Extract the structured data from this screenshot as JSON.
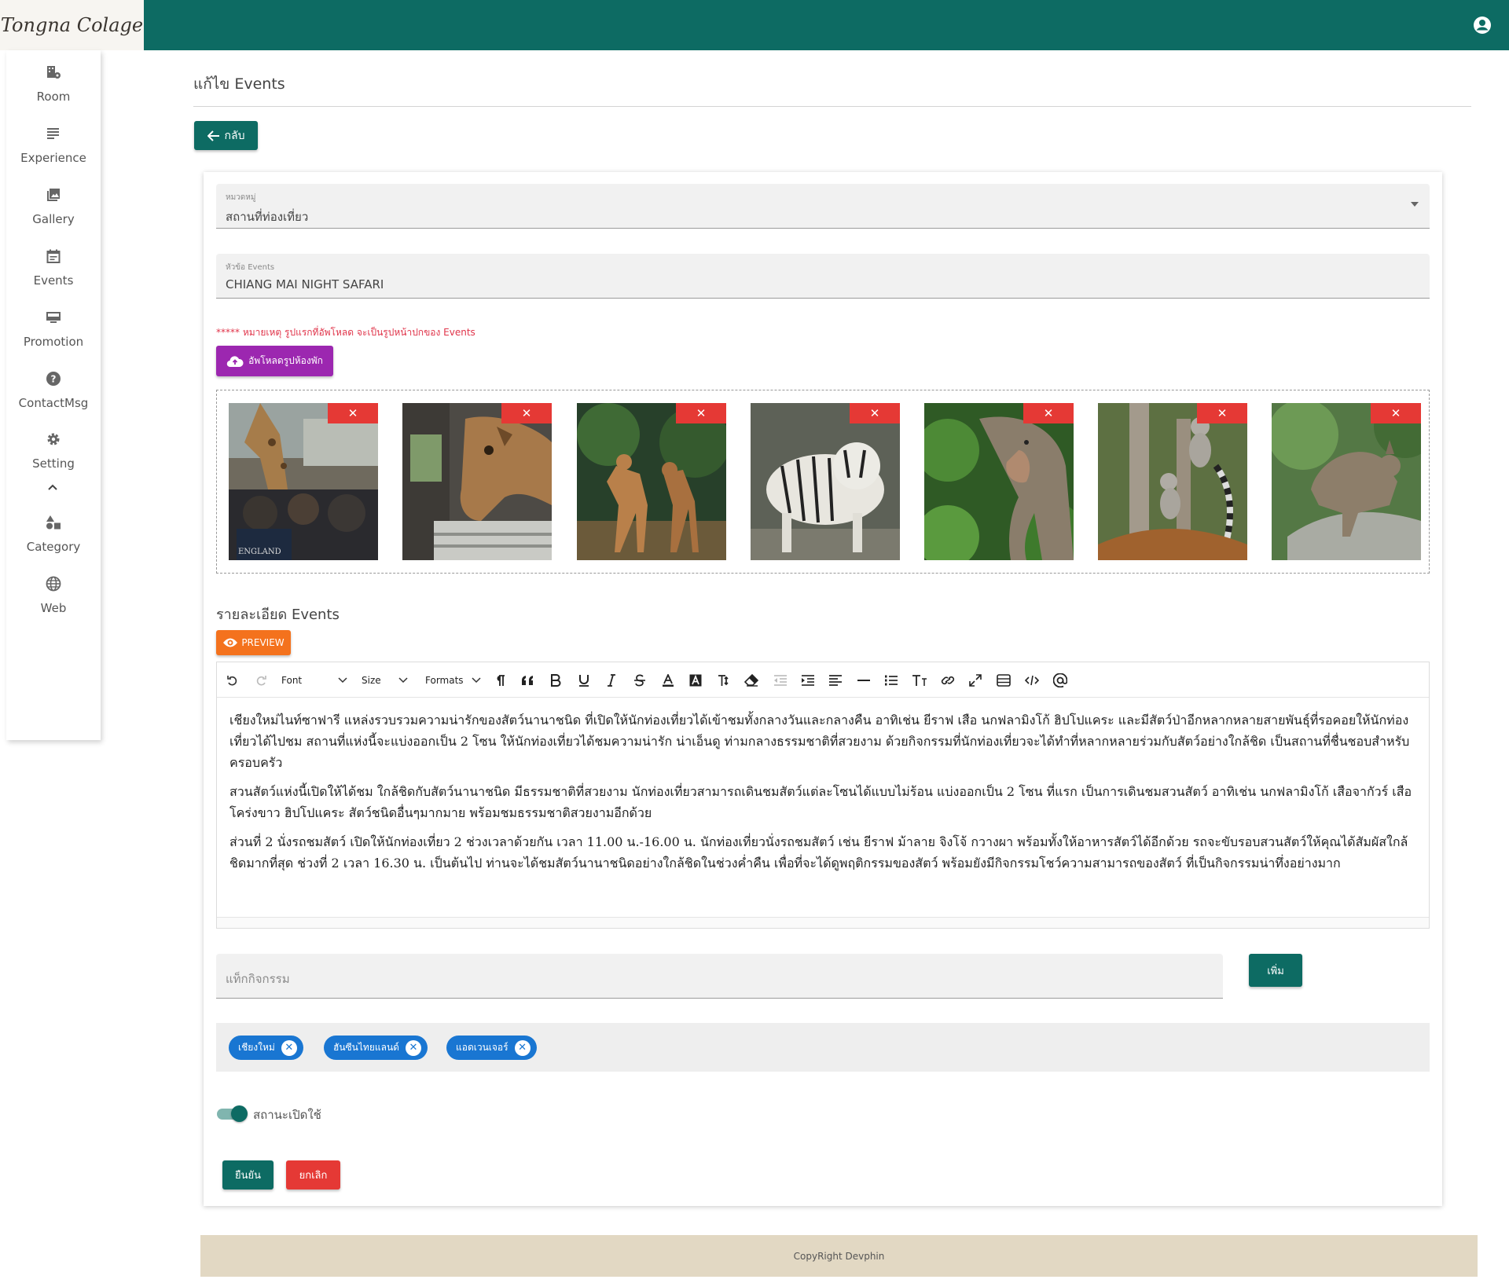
{
  "header": {
    "logo_text": "Tongna Colage",
    "user_icon": "account-circle-icon",
    "bar_color": "#0d6b63"
  },
  "sidebar": {
    "items": [
      {
        "label": "Room",
        "icon": "room-settings-icon"
      },
      {
        "label": "Experience",
        "icon": "list-icon"
      },
      {
        "label": "Gallery",
        "icon": "photo-library-icon"
      },
      {
        "label": "Events",
        "icon": "event-note-icon"
      },
      {
        "label": "Promotion",
        "icon": "monitor-icon"
      },
      {
        "label": "ContactMsg",
        "icon": "help-icon"
      },
      {
        "label": "Setting",
        "icon": "gear-icon"
      },
      {
        "label": "Category",
        "icon": "shapes-icon"
      },
      {
        "label": "Web",
        "icon": "globe-icon"
      }
    ],
    "collapse_icon": "chevron-up-icon"
  },
  "page": {
    "title": "แก้ไข Events",
    "back_label": "กลับ"
  },
  "form": {
    "category": {
      "label": "หมวดหมู่",
      "value": "สถานที่ท่องเที่ยว"
    },
    "event_title": {
      "label": "หัวข้อ Events",
      "value": "CHIANG MAI NIGHT SAFARI"
    },
    "upload_note": "***** หมายเหตุ รูปแรกที่อัพโหลด จะเป็นรูปหน้าปกของ Events",
    "upload_label": "อัพโหลดรูปห้องพัก",
    "images": [
      {
        "subject": "giraffe-bus",
        "delete_label": "✕"
      },
      {
        "subject": "giraffe-closeup",
        "delete_label": "✕"
      },
      {
        "subject": "deer",
        "delete_label": "✕"
      },
      {
        "subject": "white-tiger",
        "delete_label": "✕"
      },
      {
        "subject": "elephant",
        "delete_label": "✕"
      },
      {
        "subject": "lemurs",
        "delete_label": "✕"
      },
      {
        "subject": "kangaroo",
        "delete_label": "✕"
      }
    ],
    "details_title": "รายละเอียด Events",
    "preview_label": "PREVIEW",
    "editor": {
      "toolbar": {
        "font": "Font",
        "size": "Size",
        "formats": "Formats"
      },
      "paragraphs": [
        "เชียงใหม่ไนท์ซาฟารี แหล่งรวบรวมความน่ารักของสัตว์นานาชนิด ที่เปิดให้นักท่องเที่ยวได้เข้าชมทั้งกลางวันและกลางคืน อาทิเช่น ยีราฟ เสือ นกฟลามิงโก้ ฮิปโปแคระ และมีสัตว์ป่าอีกหลากหลายสายพันธุ์ที่รอคอยให้นักท่องเที่ยวได้ไปชม สถานที่แห่งนี้จะแบ่งออกเป็น 2 โซน ให้นักท่องเที่ยวได้ชมความน่ารัก น่าเอ็นดู ท่ามกลางธรรมชาติที่สวยงาม ด้วยกิจกรรมที่นักท่องเที่ยวจะได้ทำที่หลากหลายร่วมกับสัตว์อย่างใกล้ชิด เป็นสถานที่ชื่นชอบสำหรับครอบครัว",
        "สวนสัตว์แห่งนี้เปิดให้ได้ชม ใกล้ชิดกับสัตว์นานาชนิด มีธรรมชาติที่สวยงาม นักท่องเที่ยวสามารถเดินชมสัตว์แต่ละโซนได้แบบไม่ร้อน แบ่งออกเป็น 2 โซน ที่แรก เป็นการเดินชมสวนสัตว์ อาทิเช่น นกฟลามิงโก้ เสือจากัวร์ เสือโคร่งขาว ฮิปโปแคระ สัตว์ชนิดอื่นๆมากมาย พร้อมชมธรรมชาติสวยงามอีกด้วย",
        "ส่วนที่ 2 นั่งรถชมสัตว์ เปิดให้นักท่องเที่ยว 2 ช่วงเวลาด้วยกัน เวลา 11.00 น.-16.00 น. นักท่องเที่ยวนั่งรถชมสัตว์ เช่น ยีราฟ ม้าลาย จิงโจ้ กวางผา พร้อมทั้งให้อาหารสัตว์ได้อีกด้วย รถจะขับรอบสวนสัตว์ให้คุณได้สัมผัสใกล้ชิดมากที่สุด ช่วงที่ 2 เวลา 16.30 น. เป็นต้นไป ท่านจะได้ชมสัตว์นานาชนิดอย่างใกล้ชิดในช่วงค่ำคืน เพื่อที่จะได้ดูพฤติกรรมของสัตว์ พร้อมยังมีกิจกรรมโชว์ความสามารถของสัตว์ ที่เป็นกิจกรรมน่าทึ่งอย่างมาก"
      ]
    },
    "tag_placeholder": "แท็กกิจกรรม",
    "add_label": "เพิ่ม",
    "tags": [
      "เชียงใหม่",
      "ฮันซีนไทยแลนด์",
      "แอดเวนเจอร์"
    ],
    "status_label": "สถานะเปิดใช้",
    "status_on": true,
    "confirm_label": "ยืนยัน",
    "cancel_label": "ยกเลิก"
  },
  "footer": {
    "text": "CopyRight Devphin"
  }
}
